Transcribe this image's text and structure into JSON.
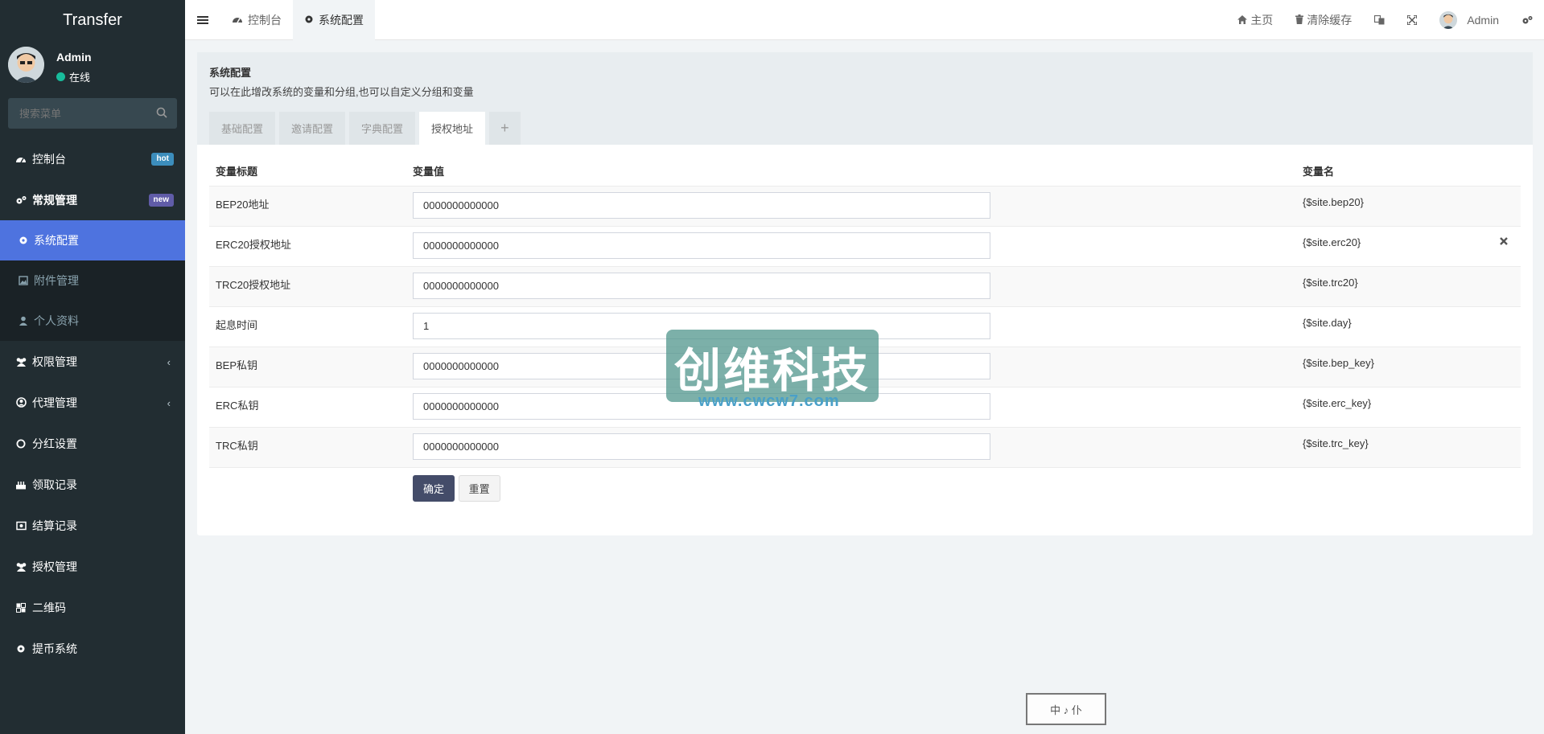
{
  "app": {
    "title": "Transfer"
  },
  "user": {
    "name": "Admin",
    "status": "在线"
  },
  "search": {
    "placeholder": "搜索菜单"
  },
  "sidebar": {
    "items": [
      {
        "label": "控制台",
        "badge": "hot"
      },
      {
        "label": "常规管理",
        "badge": "new"
      }
    ],
    "subitems": [
      {
        "label": "系统配置"
      },
      {
        "label": "附件管理"
      },
      {
        "label": "个人资料"
      }
    ],
    "more": [
      {
        "label": "权限管理"
      },
      {
        "label": "代理管理"
      },
      {
        "label": "分红设置"
      },
      {
        "label": "领取记录"
      },
      {
        "label": "结算记录"
      },
      {
        "label": "授权管理"
      },
      {
        "label": "二维码"
      },
      {
        "label": "提币系统"
      }
    ]
  },
  "header": {
    "tabs": [
      {
        "label": "控制台"
      },
      {
        "label": "系统配置"
      }
    ],
    "links": {
      "home": "主页",
      "clear_cache": "清除缓存",
      "user": "Admin"
    }
  },
  "panel": {
    "title": "系统配置",
    "description": "可以在此增改系统的变量和分组,也可以自定义分组和变量",
    "tabs": [
      {
        "label": "基础配置"
      },
      {
        "label": "邀请配置"
      },
      {
        "label": "字典配置"
      },
      {
        "label": "授权地址"
      },
      {
        "label": "+"
      }
    ]
  },
  "table": {
    "headers": {
      "title": "变量标题",
      "value": "变量值",
      "name": "变量名"
    },
    "rows": [
      {
        "title": "BEP20地址",
        "value": "0000000000000",
        "name": "{$site.bep20}"
      },
      {
        "title": "ERC20授权地址",
        "value": "0000000000000",
        "name": "{$site.erc20}"
      },
      {
        "title": "TRC20授权地址",
        "value": "0000000000000",
        "name": "{$site.trc20}"
      },
      {
        "title": "起息时间",
        "value": "1",
        "name": "{$site.day}"
      },
      {
        "title": "BEP私钥",
        "value": "0000000000000",
        "name": "{$site.bep_key}"
      },
      {
        "title": "ERC私钥",
        "value": "0000000000000",
        "name": "{$site.erc_key}"
      },
      {
        "title": "TRC私钥",
        "value": "0000000000000",
        "name": "{$site.trc_key}"
      }
    ]
  },
  "buttons": {
    "confirm": "确定",
    "reset": "重置"
  },
  "watermark": {
    "text": "创维科技",
    "url": "www.cwcw7.com"
  },
  "stamp": {
    "text": "中 ♪ 仆"
  }
}
